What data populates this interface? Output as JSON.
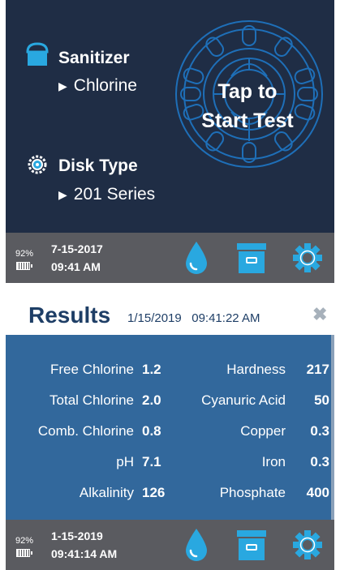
{
  "screen1": {
    "sanitizer": {
      "label": "Sanitizer",
      "value": "Chlorine",
      "icon": "sanitizer-bottle-icon"
    },
    "disk_type": {
      "label": "Disk Type",
      "value": "201 Series",
      "icon": "disk-gear-icon"
    },
    "start": {
      "text_line1": "Tap to",
      "text_line2": "Start Test"
    },
    "footer": {
      "battery_pct": "92%",
      "date": "7-15-2017",
      "time": "09:41 AM"
    }
  },
  "screen2": {
    "header": {
      "title": "Results",
      "datetime": "1/15/2019   09:41:22 AM",
      "close_icon": "close-icon"
    },
    "results_left": [
      {
        "label": "Free Chlorine",
        "value": "1.2"
      },
      {
        "label": "Total Chlorine",
        "value": "2.0"
      },
      {
        "label": "Comb. Chlorine",
        "value": "0.8"
      },
      {
        "label": "pH",
        "value": "7.1"
      },
      {
        "label": "Alkalinity",
        "value": "126"
      }
    ],
    "results_right": [
      {
        "label": "Hardness",
        "value": "217"
      },
      {
        "label": "Cyanuric Acid",
        "value": "50"
      },
      {
        "label": "Copper",
        "value": "0.3"
      },
      {
        "label": "Iron",
        "value": "0.3"
      },
      {
        "label": "Phosphate",
        "value": "400"
      }
    ],
    "footer": {
      "battery_pct": "92%",
      "date": "1-15-2019",
      "time": "09:41:14 AM"
    }
  },
  "colors": {
    "screen1_bg": "#1f2d45",
    "screen2_bg": "#32689c",
    "footer_bg": "#5a5b60",
    "accent_blue": "#29a8e0",
    "header_text": "#1e3e66"
  },
  "icons": [
    "water-drop-icon",
    "archive-box-icon",
    "settings-gear-icon",
    "battery-icon"
  ]
}
